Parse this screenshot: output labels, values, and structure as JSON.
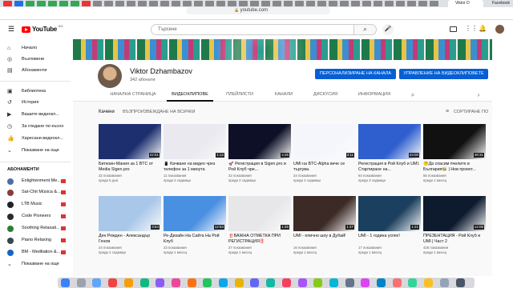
{
  "browser": {
    "url": "youtube.com",
    "tab_active": "Viktor D",
    "tab_second": "Facebook"
  },
  "header": {
    "logo_text": "YouTube",
    "logo_region": "BG",
    "search_placeholder": "Търсене",
    "search_icon": "search-icon",
    "mic_icon": "mic-icon"
  },
  "sidebar": {
    "main_items": [
      {
        "label": "Начало",
        "icon": "home-icon"
      },
      {
        "label": "Възловени",
        "icon": "compass-icon"
      },
      {
        "label": "Абонаменти",
        "icon": "subscriptions-icon"
      }
    ],
    "library_items": [
      {
        "label": "Библиотека",
        "icon": "library-icon"
      },
      {
        "label": "История",
        "icon": "history-icon"
      },
      {
        "label": "Вашите видеокл...",
        "icon": "video-icon"
      },
      {
        "label": "За гледане по-късно",
        "icon": "clock-icon"
      },
      {
        "label": "Харесани видеокл...",
        "icon": "thumb-up-icon"
      },
      {
        "label": "Показване на още",
        "icon": "chevron-down-icon"
      }
    ],
    "subs_heading": "АБОНАМЕНТИ",
    "subs": [
      {
        "label": "Enlightenment Me...",
        "color": "#4a6fa5"
      },
      {
        "label": "Sat-Chit Música &...",
        "color": "#8a3b3b"
      },
      {
        "label": "LTB Music",
        "color": "#222222"
      },
      {
        "label": "Code Pioneers",
        "color": "#2b2b2b"
      },
      {
        "label": "Soothing Relaxati...",
        "color": "#2e7d32"
      },
      {
        "label": "Piano Relaxing",
        "color": "#37474f"
      },
      {
        "label": "BM - Meditation &...",
        "color": "#1565c0"
      },
      {
        "label": "Показване на още",
        "color": "#606060"
      }
    ]
  },
  "channel": {
    "name": "Viktor Dzhambazov",
    "subscribers": "342 абонати",
    "customize_button": "ПЕРСОНАЛИЗИРАНЕ НА КАНАЛА",
    "manage_button": "УПРАВЛЕНИЕ НА ВИДЕОКЛИПОВЕТЕ",
    "tabs": [
      "НАЧАЛНА СТРАНИЦА",
      "ВИДЕОКЛИПОВЕ",
      "ПЛЕЙЛИСТИ",
      "КАНАЛИ",
      "ДИСКУСИЯ",
      "ИНФОРМАЦИЯ"
    ],
    "selected_tab": "ВИДЕОКЛИПОВЕ"
  },
  "uploads": {
    "label": "Качени",
    "play_all": "ВЪЗПРОИЗВЕЖДАНЕ НА ВСИЧКИ",
    "sort": "СОРТИРАНЕ ПО"
  },
  "videos": [
    {
      "title": "Биткоин-Мания за 1 BTC от Media Sigen.pro",
      "views": "32 показвания",
      "date": "преди 5 дни",
      "duration": "22:51",
      "thumb": "#1d2f6f"
    },
    {
      "title": "📱 Качване на видео чрез телефон за 1 минута",
      "views": "11 показвания",
      "date": "преди 2 седмици",
      "duration": "1:12",
      "thumb": "#e9e9ef"
    },
    {
      "title": "🚀 Регистрация в Sigen.pro и Рой Клуб чре...",
      "views": "22 показвания",
      "date": "преди 2 седмици",
      "duration": "4:25",
      "thumb": "#0d1026"
    },
    {
      "title": "UMI на BTC-Alpha вече се търгува.",
      "views": "24 показвания",
      "date": "преди 2 седмици",
      "duration": "3:11",
      "thumb": "#f4f6fb"
    },
    {
      "title": "Регистрация в Рой Клуб и UMI. Стартиране на...",
      "views": "64 показвания",
      "date": "преди 3 седмици",
      "duration": "23:00",
      "thumb": "#2f5fcf"
    },
    {
      "title": "🤔Да спасим пчелите в България🐝 | Нов проект...",
      "views": "56 показвания",
      "date": "преди 1 месец",
      "duration": "49:31",
      "thumb": "#111111"
    },
    {
      "title": "Ден Рожден - Александър Генов",
      "views": "24 показвания",
      "date": "преди 4 седмици",
      "duration": "3:54",
      "thumb": "#a9c7e8"
    },
    {
      "title": "Ре-Дизайн На Сайта На Рой Клуб",
      "views": "23 показвания",
      "date": "преди 1 месец",
      "duration": "12:54",
      "thumb": "#4a90e2"
    },
    {
      "title": "‼️ВАЖНА ОТМЕТКА ПРИ РЕГИСТРАЦИЯ‼️",
      "views": "27 показвания",
      "date": "преди 1 месец",
      "duration": "1:45",
      "thumb": "#e7e7ea"
    },
    {
      "title": "UMI - епично шоу в Дубай!",
      "views": "16 показвания",
      "date": "преди 1 месец",
      "duration": "1:27",
      "thumb": "#3b2a26"
    },
    {
      "title": "UMI - 1 година успех!",
      "views": "17 показвания",
      "date": "преди 1 месец",
      "duration": "1:21",
      "thumb": "#1b3f5e"
    },
    {
      "title": "ПРЕЗЕНТАЦИЯ - Рой Клуб и UMI | Част 2",
      "views": "426 показвания",
      "date": "преди 1 месец",
      "duration": "14:06",
      "thumb": "#0e1a2e"
    }
  ],
  "dock_colors": [
    "#3b82f6",
    "#9ca3af",
    "#60a5fa",
    "#ef4444",
    "#f59e0b",
    "#10b981",
    "#8b5cf6",
    "#ec4899",
    "#f97316",
    "#22c55e",
    "#0ea5e9",
    "#eab308",
    "#6366f1",
    "#14b8a6",
    "#f43f5e",
    "#a855f7",
    "#84cc16",
    "#06b6d4",
    "#64748b",
    "#d946ef",
    "#0284c7",
    "#f87171",
    "#34d399",
    "#fbbf24",
    "#94a3b8",
    "#475569"
  ]
}
